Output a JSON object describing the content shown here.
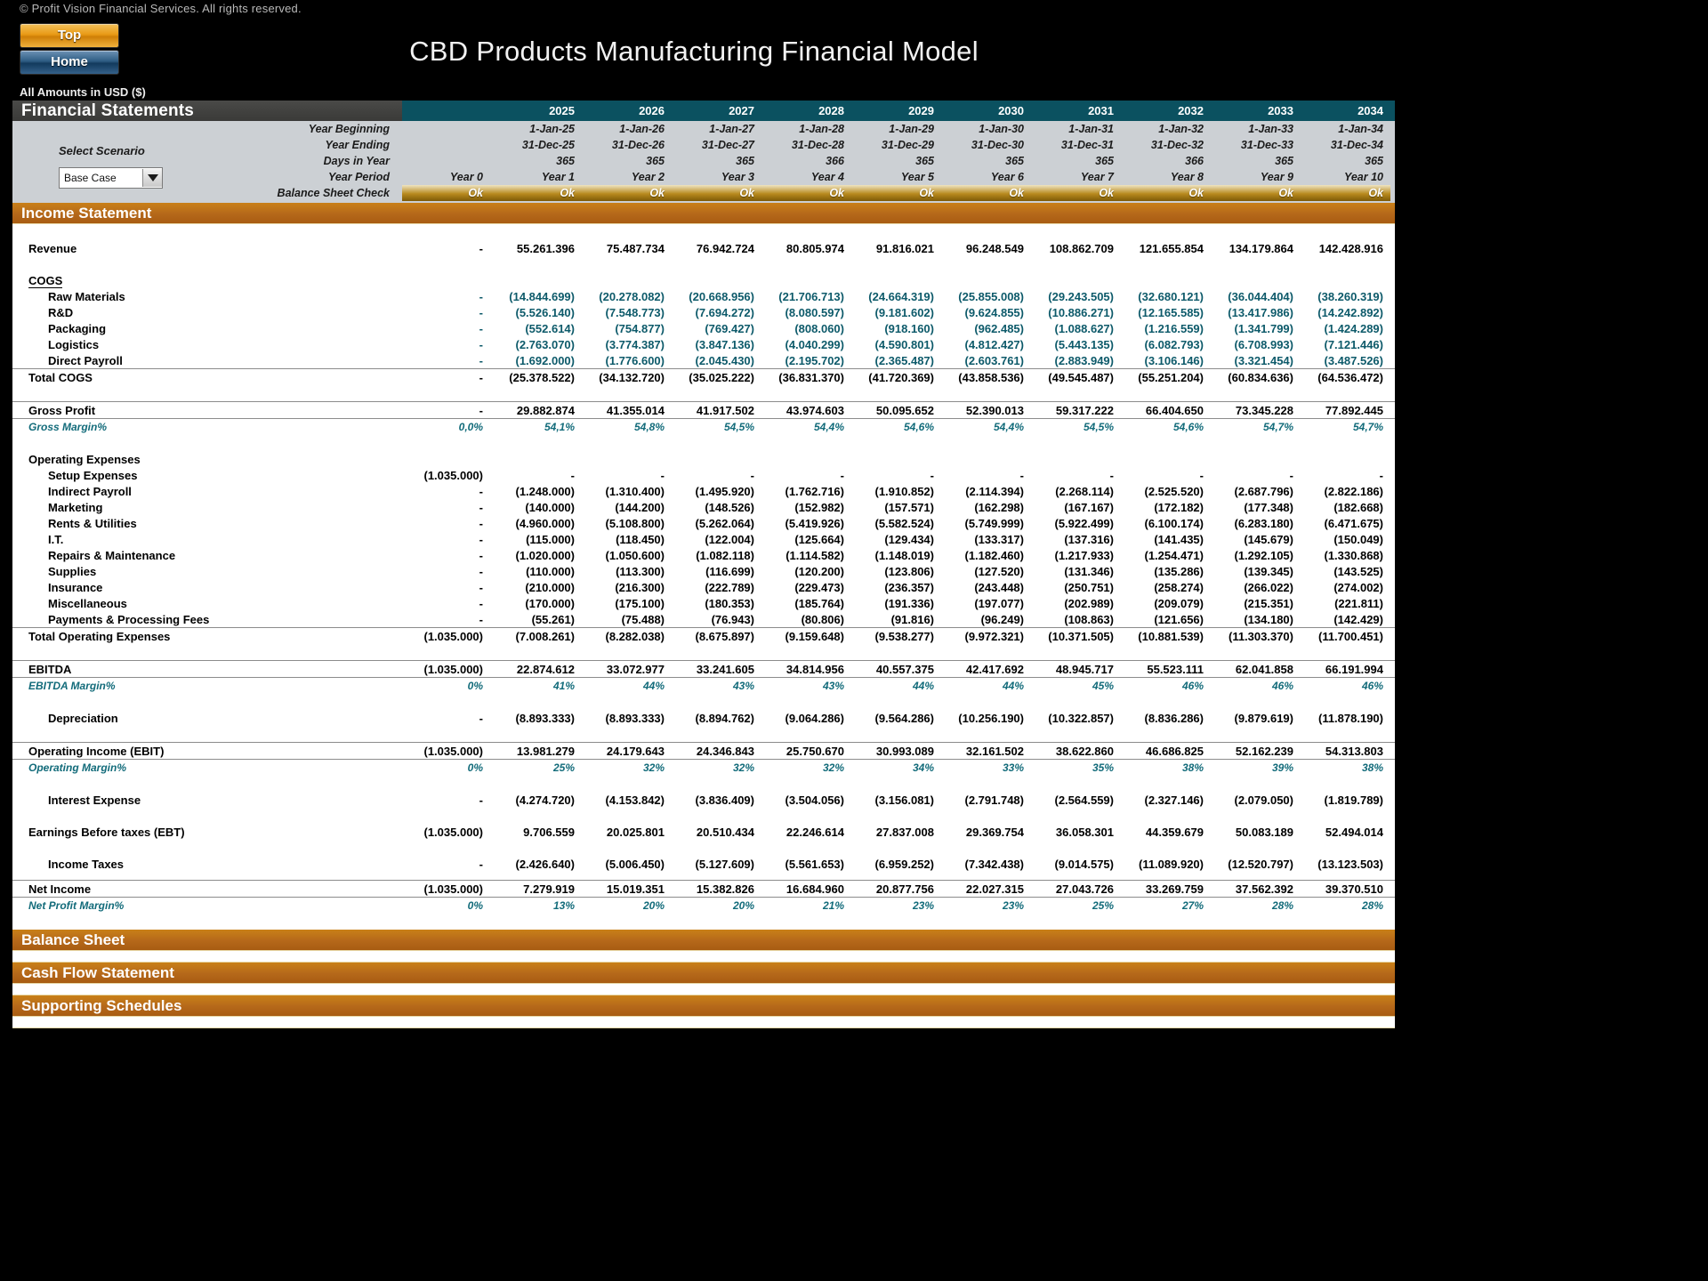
{
  "window": {
    "copyright": "© Profit Vision Financial Services. All rights reserved.",
    "title": "CBD Products Manufacturing Financial Model",
    "amounts_note": "All Amounts in  USD ($)"
  },
  "nav": {
    "top_label": "Top",
    "home_label": "Home"
  },
  "header": {
    "section_title": "Financial Statements",
    "years": [
      "2025",
      "2026",
      "2027",
      "2028",
      "2029",
      "2030",
      "2031",
      "2032",
      "2033",
      "2034"
    ]
  },
  "scenario": {
    "label": "Select Scenario",
    "selected": "Base Case",
    "options": [
      "Base Case"
    ]
  },
  "info_rows": {
    "year_beginning": {
      "label": "Year Beginning",
      "year0": "",
      "values": [
        "1-Jan-25",
        "1-Jan-26",
        "1-Jan-27",
        "1-Jan-28",
        "1-Jan-29",
        "1-Jan-30",
        "1-Jan-31",
        "1-Jan-32",
        "1-Jan-33",
        "1-Jan-34"
      ]
    },
    "year_ending": {
      "label": "Year Ending",
      "year0": "",
      "values": [
        "31-Dec-25",
        "31-Dec-26",
        "31-Dec-27",
        "31-Dec-28",
        "31-Dec-29",
        "31-Dec-30",
        "31-Dec-31",
        "31-Dec-32",
        "31-Dec-33",
        "31-Dec-34"
      ]
    },
    "days_in_year": {
      "label": "Days in Year",
      "year0": "",
      "values": [
        "365",
        "365",
        "365",
        "366",
        "365",
        "365",
        "365",
        "366",
        "365",
        "365"
      ]
    },
    "year_period": {
      "label": "Year Period",
      "year0": "Year 0",
      "values": [
        "Year 1",
        "Year 2",
        "Year 3",
        "Year 4",
        "Year 5",
        "Year 6",
        "Year 7",
        "Year 8",
        "Year 9",
        "Year 10"
      ]
    },
    "balance_sheet_check": {
      "label": "Balance Sheet Check",
      "year0": "Ok",
      "values": [
        "Ok",
        "Ok",
        "Ok",
        "Ok",
        "Ok",
        "Ok",
        "Ok",
        "Ok",
        "Ok",
        "Ok"
      ]
    }
  },
  "sections": {
    "income_statement": "Income Statement",
    "balance_sheet": "Balance Sheet",
    "cash_flow": "Cash Flow Statement",
    "supporting_schedules": "Supporting Schedules"
  },
  "income_statement": {
    "revenue": {
      "label": "Revenue",
      "year0": "-",
      "values": [
        "55.261.396",
        "75.487.734",
        "76.942.724",
        "80.805.974",
        "91.816.021",
        "96.248.549",
        "108.862.709",
        "121.655.854",
        "134.179.864",
        "142.428.916"
      ]
    },
    "cogs_header": "COGS",
    "raw_materials": {
      "label": "Raw Materials",
      "year0": "-",
      "values": [
        "(14.844.699)",
        "(20.278.082)",
        "(20.668.956)",
        "(21.706.713)",
        "(24.664.319)",
        "(25.855.008)",
        "(29.243.505)",
        "(32.680.121)",
        "(36.044.404)",
        "(38.260.319)"
      ]
    },
    "rnd": {
      "label": "R&D",
      "year0": "-",
      "values": [
        "(5.526.140)",
        "(7.548.773)",
        "(7.694.272)",
        "(8.080.597)",
        "(9.181.602)",
        "(9.624.855)",
        "(10.886.271)",
        "(12.165.585)",
        "(13.417.986)",
        "(14.242.892)"
      ]
    },
    "packaging": {
      "label": "Packaging",
      "year0": "-",
      "values": [
        "(552.614)",
        "(754.877)",
        "(769.427)",
        "(808.060)",
        "(918.160)",
        "(962.485)",
        "(1.088.627)",
        "(1.216.559)",
        "(1.341.799)",
        "(1.424.289)"
      ]
    },
    "logistics": {
      "label": "Logistics",
      "year0": "-",
      "values": [
        "(2.763.070)",
        "(3.774.387)",
        "(3.847.136)",
        "(4.040.299)",
        "(4.590.801)",
        "(4.812.427)",
        "(5.443.135)",
        "(6.082.793)",
        "(6.708.993)",
        "(7.121.446)"
      ]
    },
    "direct_payroll": {
      "label": "Direct Payroll",
      "year0": "-",
      "values": [
        "(1.692.000)",
        "(1.776.600)",
        "(2.045.430)",
        "(2.195.702)",
        "(2.365.487)",
        "(2.603.761)",
        "(2.883.949)",
        "(3.106.146)",
        "(3.321.454)",
        "(3.487.526)"
      ]
    },
    "total_cogs": {
      "label": "Total COGS",
      "year0": "-",
      "values": [
        "(25.378.522)",
        "(34.132.720)",
        "(35.025.222)",
        "(36.831.370)",
        "(41.720.369)",
        "(43.858.536)",
        "(49.545.487)",
        "(55.251.204)",
        "(60.834.636)",
        "(64.536.472)"
      ]
    },
    "gross_profit": {
      "label": "Gross Profit",
      "year0": "-",
      "values": [
        "29.882.874",
        "41.355.014",
        "41.917.502",
        "43.974.603",
        "50.095.652",
        "52.390.013",
        "59.317.222",
        "66.404.650",
        "73.345.228",
        "77.892.445"
      ]
    },
    "gross_margin": {
      "label": "Gross Margin%",
      "year0": "0,0%",
      "values": [
        "54,1%",
        "54,8%",
        "54,5%",
        "54,4%",
        "54,6%",
        "54,4%",
        "54,5%",
        "54,6%",
        "54,7%",
        "54,7%"
      ]
    },
    "opex_header": "Operating Expenses",
    "setup_expenses": {
      "label": "Setup Expenses",
      "year0": "(1.035.000)",
      "values": [
        "-",
        "-",
        "-",
        "-",
        "-",
        "-",
        "-",
        "-",
        "-",
        "-"
      ]
    },
    "indirect_payroll": {
      "label": "Indirect Payroll",
      "year0": "-",
      "values": [
        "(1.248.000)",
        "(1.310.400)",
        "(1.495.920)",
        "(1.762.716)",
        "(1.910.852)",
        "(2.114.394)",
        "(2.268.114)",
        "(2.525.520)",
        "(2.687.796)",
        "(2.822.186)"
      ]
    },
    "marketing": {
      "label": "Marketing",
      "year0": "-",
      "values": [
        "(140.000)",
        "(144.200)",
        "(148.526)",
        "(152.982)",
        "(157.571)",
        "(162.298)",
        "(167.167)",
        "(172.182)",
        "(177.348)",
        "(182.668)"
      ]
    },
    "rents_utilities": {
      "label": "Rents & Utilities",
      "year0": "-",
      "values": [
        "(4.960.000)",
        "(5.108.800)",
        "(5.262.064)",
        "(5.419.926)",
        "(5.582.524)",
        "(5.749.999)",
        "(5.922.499)",
        "(6.100.174)",
        "(6.283.180)",
        "(6.471.675)"
      ]
    },
    "it": {
      "label": "I.T.",
      "year0": "-",
      "values": [
        "(115.000)",
        "(118.450)",
        "(122.004)",
        "(125.664)",
        "(129.434)",
        "(133.317)",
        "(137.316)",
        "(141.435)",
        "(145.679)",
        "(150.049)"
      ]
    },
    "repairs_maintenance": {
      "label": "Repairs & Maintenance",
      "year0": "-",
      "values": [
        "(1.020.000)",
        "(1.050.600)",
        "(1.082.118)",
        "(1.114.582)",
        "(1.148.019)",
        "(1.182.460)",
        "(1.217.933)",
        "(1.254.471)",
        "(1.292.105)",
        "(1.330.868)"
      ]
    },
    "supplies": {
      "label": "Supplies",
      "year0": "-",
      "values": [
        "(110.000)",
        "(113.300)",
        "(116.699)",
        "(120.200)",
        "(123.806)",
        "(127.520)",
        "(131.346)",
        "(135.286)",
        "(139.345)",
        "(143.525)"
      ]
    },
    "insurance": {
      "label": "Insurance",
      "year0": "-",
      "values": [
        "(210.000)",
        "(216.300)",
        "(222.789)",
        "(229.473)",
        "(236.357)",
        "(243.448)",
        "(250.751)",
        "(258.274)",
        "(266.022)",
        "(274.002)"
      ]
    },
    "miscellaneous": {
      "label": "Miscellaneous",
      "year0": "-",
      "values": [
        "(170.000)",
        "(175.100)",
        "(180.353)",
        "(185.764)",
        "(191.336)",
        "(197.077)",
        "(202.989)",
        "(209.079)",
        "(215.351)",
        "(221.811)"
      ]
    },
    "payments_processing": {
      "label": "Payments & Processing Fees",
      "year0": "-",
      "values": [
        "(55.261)",
        "(75.488)",
        "(76.943)",
        "(80.806)",
        "(91.816)",
        "(96.249)",
        "(108.863)",
        "(121.656)",
        "(134.180)",
        "(142.429)"
      ]
    },
    "total_opex": {
      "label": "Total Operating Expenses",
      "year0": "(1.035.000)",
      "values": [
        "(7.008.261)",
        "(8.282.038)",
        "(8.675.897)",
        "(9.159.648)",
        "(9.538.277)",
        "(9.972.321)",
        "(10.371.505)",
        "(10.881.539)",
        "(11.303.370)",
        "(11.700.451)"
      ]
    },
    "ebitda": {
      "label": "EBITDA",
      "year0": "(1.035.000)",
      "values": [
        "22.874.612",
        "33.072.977",
        "33.241.605",
        "34.814.956",
        "40.557.375",
        "42.417.692",
        "48.945.717",
        "55.523.111",
        "62.041.858",
        "66.191.994"
      ]
    },
    "ebitda_margin": {
      "label": "EBITDA Margin%",
      "year0": "0%",
      "values": [
        "41%",
        "44%",
        "43%",
        "43%",
        "44%",
        "44%",
        "45%",
        "46%",
        "46%",
        "46%"
      ]
    },
    "depreciation": {
      "label": "Depreciation",
      "year0": "-",
      "values": [
        "(8.893.333)",
        "(8.893.333)",
        "(8.894.762)",
        "(9.064.286)",
        "(9.564.286)",
        "(10.256.190)",
        "(10.322.857)",
        "(8.836.286)",
        "(9.879.619)",
        "(11.878.190)"
      ]
    },
    "ebit": {
      "label": "Operating Income (EBIT)",
      "year0": "(1.035.000)",
      "values": [
        "13.981.279",
        "24.179.643",
        "24.346.843",
        "25.750.670",
        "30.993.089",
        "32.161.502",
        "38.622.860",
        "46.686.825",
        "52.162.239",
        "54.313.803"
      ]
    },
    "operating_margin": {
      "label": "Operating Margin%",
      "year0": "0%",
      "values": [
        "25%",
        "32%",
        "32%",
        "32%",
        "34%",
        "33%",
        "35%",
        "38%",
        "39%",
        "38%"
      ]
    },
    "interest_expense": {
      "label": "Interest Expense",
      "year0": "-",
      "values": [
        "(4.274.720)",
        "(4.153.842)",
        "(3.836.409)",
        "(3.504.056)",
        "(3.156.081)",
        "(2.791.748)",
        "(2.564.559)",
        "(2.327.146)",
        "(2.079.050)",
        "(1.819.789)"
      ]
    },
    "ebt": {
      "label": "Earnings Before taxes (EBT)",
      "year0": "(1.035.000)",
      "values": [
        "9.706.559",
        "20.025.801",
        "20.510.434",
        "22.246.614",
        "27.837.008",
        "29.369.754",
        "36.058.301",
        "44.359.679",
        "50.083.189",
        "52.494.014"
      ]
    },
    "income_taxes": {
      "label": "Income Taxes",
      "year0": "-",
      "values": [
        "(2.426.640)",
        "(5.006.450)",
        "(5.127.609)",
        "(5.561.653)",
        "(6.959.252)",
        "(7.342.438)",
        "(9.014.575)",
        "(11.089.920)",
        "(12.520.797)",
        "(13.123.503)"
      ]
    },
    "net_income": {
      "label": "Net Income",
      "year0": "(1.035.000)",
      "values": [
        "7.279.919",
        "15.019.351",
        "15.382.826",
        "16.684.960",
        "20.877.756",
        "22.027.315",
        "27.043.726",
        "33.269.759",
        "37.562.392",
        "39.370.510"
      ]
    },
    "net_profit_margin": {
      "label": "Net Profit Margin%",
      "year0": "0%",
      "values": [
        "13%",
        "20%",
        "20%",
        "21%",
        "23%",
        "23%",
        "25%",
        "27%",
        "28%",
        "28%"
      ]
    }
  },
  "colors": {
    "accent_teal": "#0b5160",
    "band_orange": "#b5681a",
    "pct_teal": "#126b7a",
    "header_grey": "#4a4a48",
    "info_grey": "#ccd0d4"
  }
}
